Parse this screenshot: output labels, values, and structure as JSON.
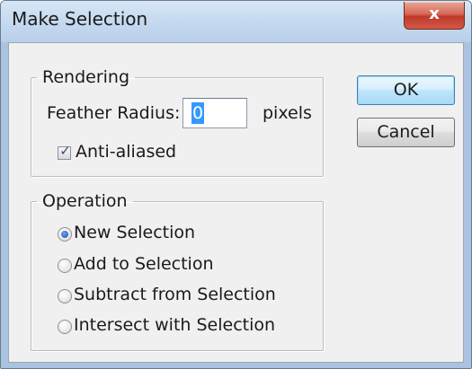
{
  "window": {
    "title": "Make Selection",
    "close_label": "x"
  },
  "rendering": {
    "legend": "Rendering",
    "feather_label": "Feather Radius:",
    "feather_value": "0",
    "feather_unit": "pixels",
    "anti_aliased_label": "Anti-aliased",
    "anti_aliased_checked": true
  },
  "operation": {
    "legend": "Operation",
    "options": [
      {
        "label": "New Selection",
        "selected": true
      },
      {
        "label": "Add to Selection",
        "selected": false
      },
      {
        "label": "Subtract from Selection",
        "selected": false
      },
      {
        "label": "Intersect with Selection",
        "selected": false
      }
    ]
  },
  "buttons": {
    "ok": "OK",
    "cancel": "Cancel"
  },
  "colors": {
    "title_bar": "#c4d9ef",
    "close_button": "#c0392b",
    "default_button": "#bee6fd",
    "radio_selected": "#2a5fbe"
  }
}
